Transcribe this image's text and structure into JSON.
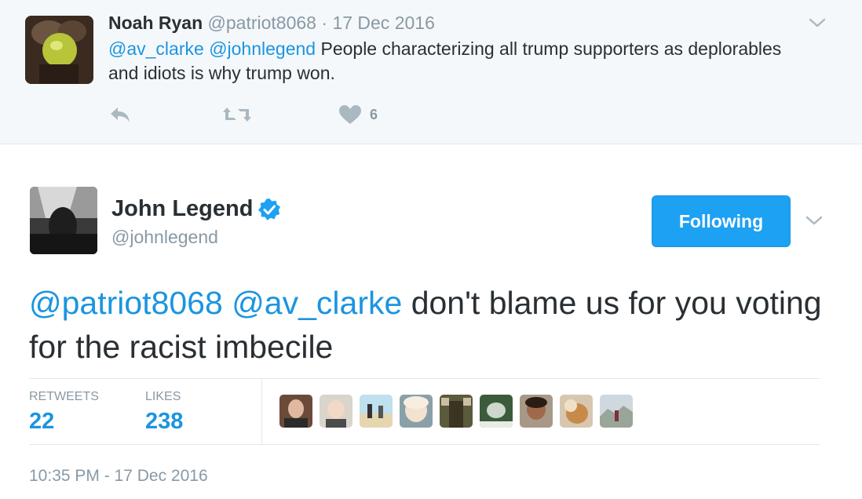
{
  "parent_tweet": {
    "name": "Noah Ryan",
    "handle": "@patriot8068",
    "separator": "·",
    "date": "17 Dec 2016",
    "text_mention_1": "@av_clarke",
    "text_mention_2": "@johnlegend",
    "text_body": "People characterizing all trump supporters as deplorables and idiots is why trump won.",
    "like_count": "6",
    "icons": [
      "reply-icon",
      "retweet-icon",
      "heart-icon",
      "chevron-down-icon"
    ]
  },
  "main_tweet": {
    "name": "John Legend",
    "handle": "@johnlegend",
    "follow_button_label": "Following",
    "text_mention_1": "@patriot8068",
    "text_mention_2": "@av_clarke",
    "text_body": "don't blame us for you voting for the racist imbecile",
    "stats": {
      "retweets_label": "RETWEETS",
      "retweets_value": "22",
      "likes_label": "LIKES",
      "likes_value": "238"
    },
    "timestamp": "10:35 PM - 17 Dec 2016",
    "likers_count_shown": 9
  },
  "colors": {
    "link_blue": "#1b95e0",
    "button_blue": "#1da1f2",
    "muted_gray": "#8899a6",
    "text_dark": "#292f33",
    "parent_bg": "#f5f8fa",
    "verified_blue": "#1da1f2"
  }
}
